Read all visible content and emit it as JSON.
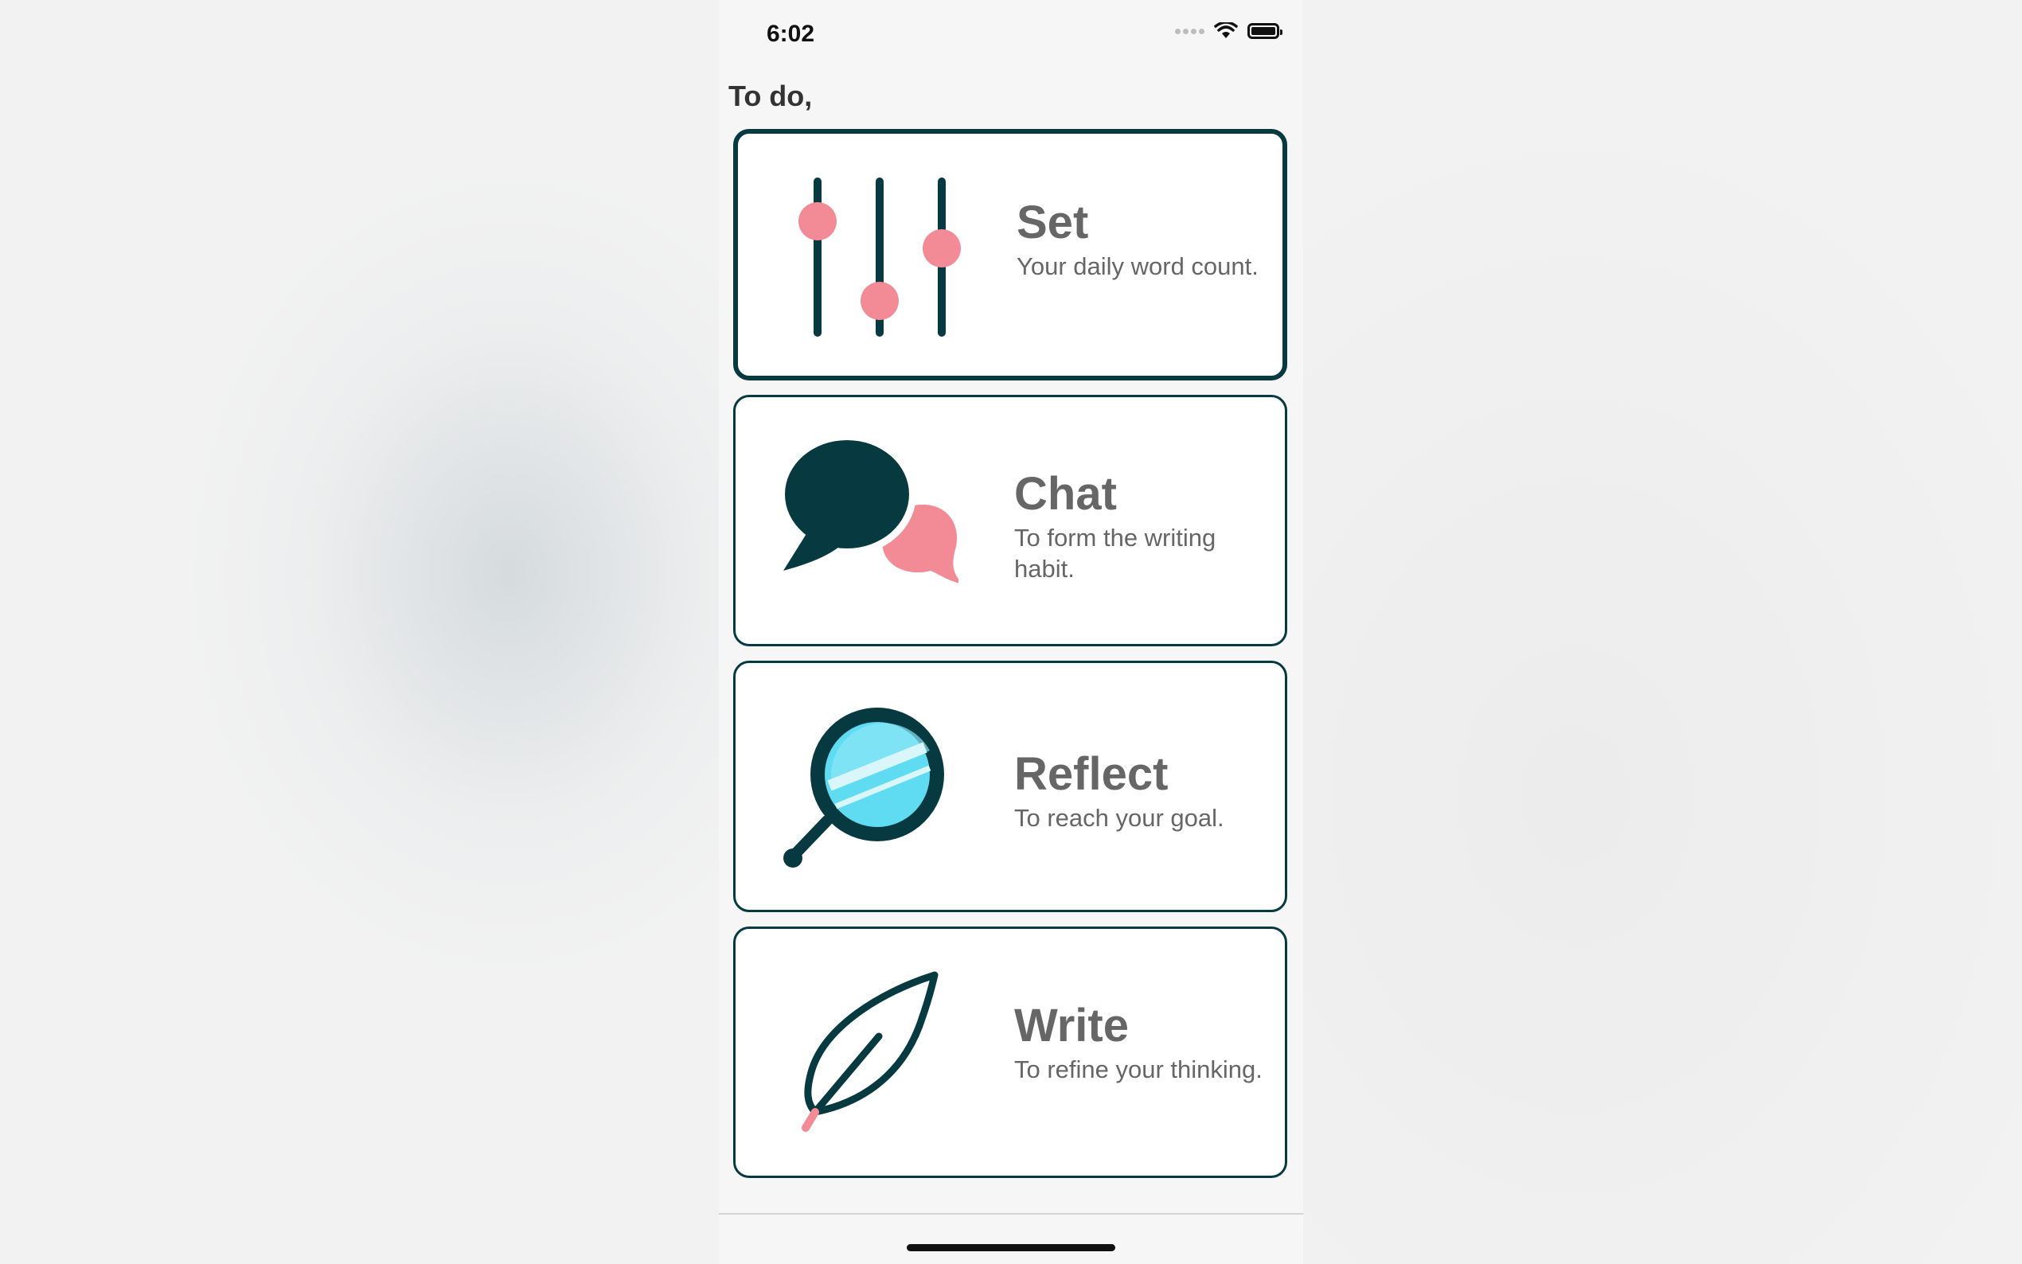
{
  "status_bar": {
    "time": "6:02"
  },
  "heading": "To do,",
  "cards": [
    {
      "title": "Set",
      "subtitle": "Your daily word count.",
      "icon": "sliders-icon",
      "active": true
    },
    {
      "title": "Chat",
      "subtitle": "To form the writing habit.",
      "icon": "chat-bubbles-icon",
      "active": false
    },
    {
      "title": "Reflect",
      "subtitle": "To reach your goal.",
      "icon": "mirror-icon",
      "active": false
    },
    {
      "title": "Write",
      "subtitle": "To refine your thinking.",
      "icon": "quill-icon",
      "active": false
    }
  ],
  "colors": {
    "accent_dark": "#063a40",
    "accent_pink": "#f28b96",
    "mirror_blue": "#5fdcf2"
  }
}
